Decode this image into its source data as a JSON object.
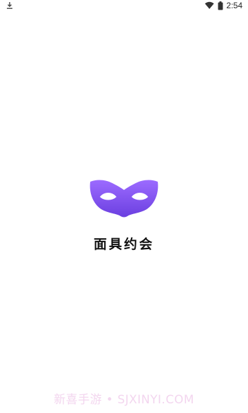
{
  "status_bar": {
    "left_icon": "download-icon",
    "wifi_icon": "wifi-icon",
    "battery_icon": "battery-icon",
    "time": "2:54"
  },
  "splash": {
    "logo_icon": "mask-logo-icon",
    "app_name": "面具约会",
    "colors": {
      "logo_top": "#9C6BFF",
      "logo_bottom": "#6B3FE0"
    }
  },
  "watermark": {
    "text": "新喜手游 • SJXINYI.COM"
  }
}
